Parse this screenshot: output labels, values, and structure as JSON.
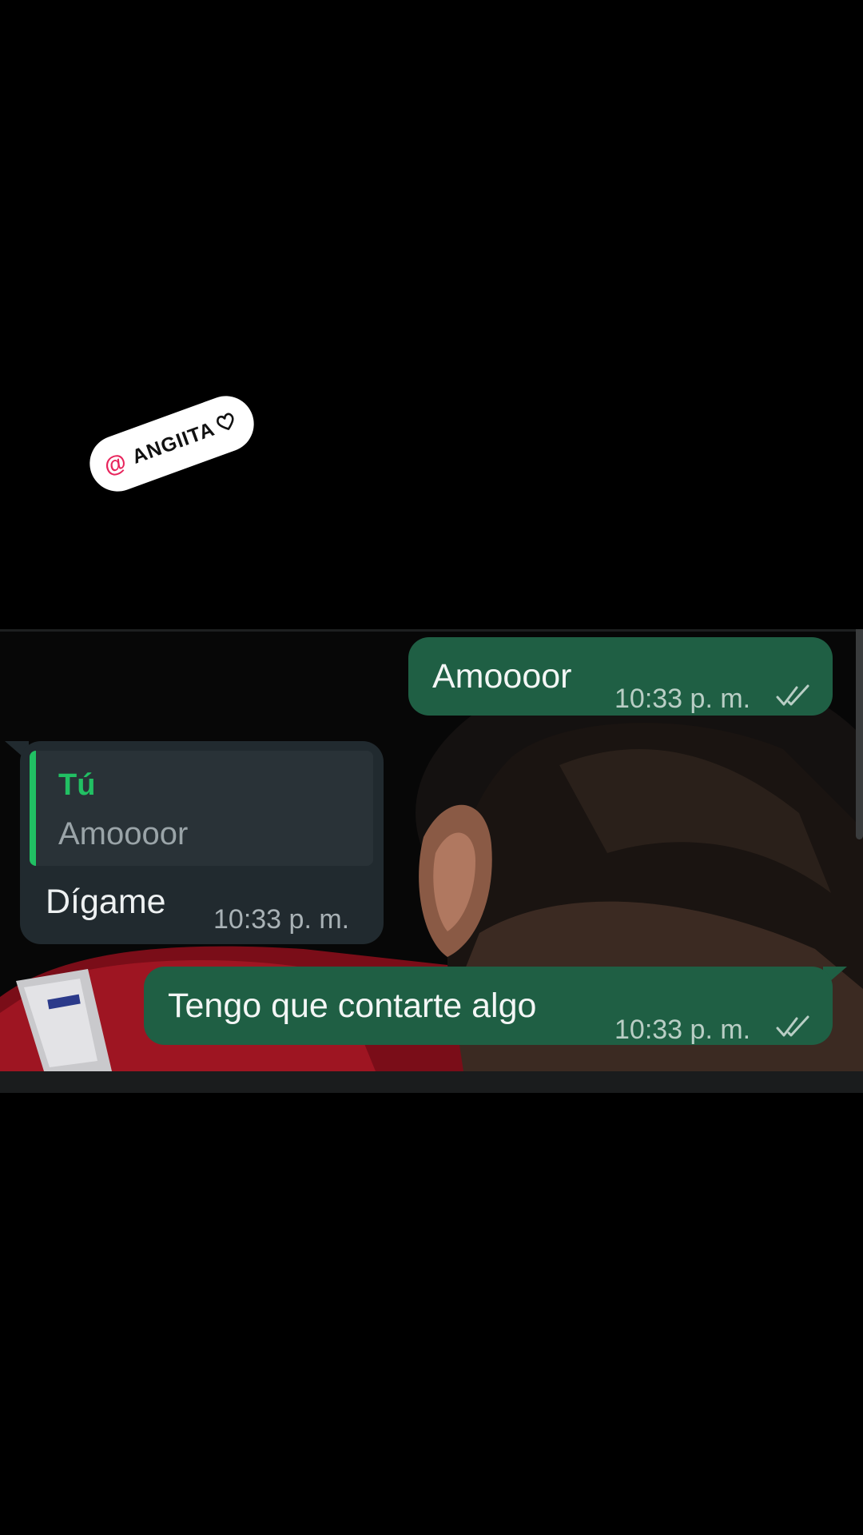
{
  "sticker": {
    "at_symbol": "@",
    "name": "ANGIITA",
    "heart_icon": "outline-heart-icon",
    "at_color": "#e8245c"
  },
  "chat": {
    "messages": [
      {
        "direction": "outgoing",
        "text": "Amoooor",
        "time": "10:33 p. m.",
        "status_icon": "double-check-icon"
      },
      {
        "direction": "incoming",
        "reply_to": {
          "author": "Tú",
          "text": "Amoooor"
        },
        "text": "Dígame",
        "time": "10:33 p. m."
      },
      {
        "direction": "outgoing",
        "text": "Tengo que contarte algo",
        "time": "10:33 p. m.",
        "status_icon": "double-check-icon"
      }
    ],
    "colors": {
      "outgoing_bubble": "#1f5f44",
      "incoming_bubble": "#212a2f",
      "reply_accent": "#21c063"
    }
  }
}
